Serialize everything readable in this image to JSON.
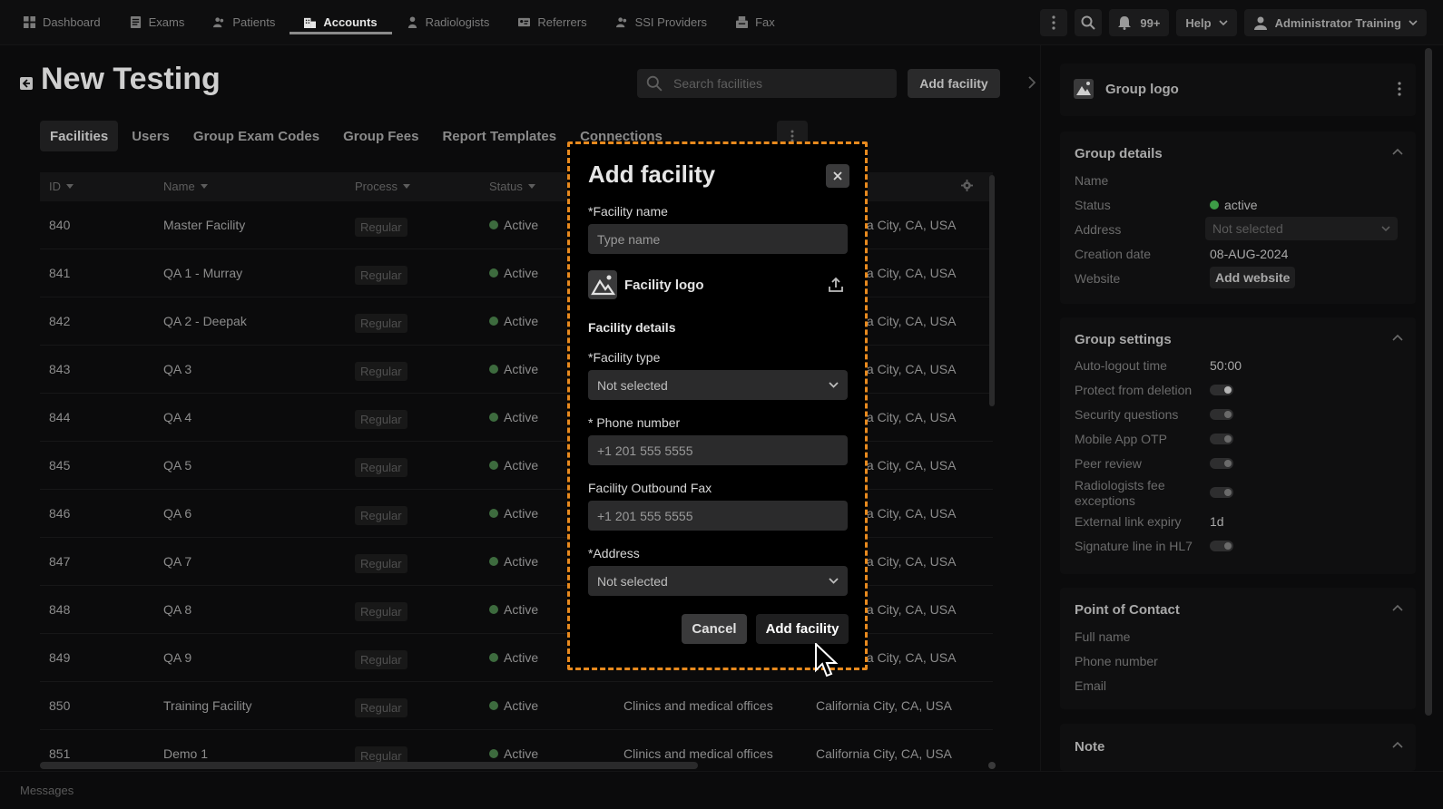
{
  "nav": {
    "items": [
      {
        "label": "Dashboard",
        "icon": "dashboard-icon"
      },
      {
        "label": "Exams",
        "icon": "exams-icon"
      },
      {
        "label": "Patients",
        "icon": "patients-icon"
      },
      {
        "label": "Accounts",
        "icon": "accounts-icon"
      },
      {
        "label": "Radiologists",
        "icon": "radiologist-icon"
      },
      {
        "label": "Referrers",
        "icon": "referrers-icon"
      },
      {
        "label": "SSI Providers",
        "icon": "ssi-providers-icon"
      },
      {
        "label": "Fax",
        "icon": "fax-icon"
      }
    ],
    "active": "Accounts",
    "notif_count": "99+",
    "help_label": "Help",
    "user_label": "Administrator Training"
  },
  "page": {
    "title": "New Testing",
    "search_placeholder": "Search facilities",
    "add_facility_label": "Add facility",
    "tabs": [
      "Facilities",
      "Users",
      "Group Exam Codes",
      "Group Fees",
      "Report Templates",
      "Connections"
    ]
  },
  "table": {
    "headers": {
      "id": "ID",
      "name": "Name",
      "process": "Process",
      "status": "Status"
    },
    "rows": [
      {
        "id": "840",
        "name": "Master Facility",
        "process": "Regular",
        "status": "Active",
        "type": "",
        "location": "nia City, CA, USA"
      },
      {
        "id": "841",
        "name": "QA 1 - Murray",
        "process": "Regular",
        "status": "Active",
        "type": "",
        "location": "nia City, CA, USA"
      },
      {
        "id": "842",
        "name": "QA 2 - Deepak",
        "process": "Regular",
        "status": "Active",
        "type": "",
        "location": "nia City, CA, USA"
      },
      {
        "id": "843",
        "name": "QA 3",
        "process": "Regular",
        "status": "Active",
        "type": "",
        "location": "nia City, CA, USA"
      },
      {
        "id": "844",
        "name": "QA 4",
        "process": "Regular",
        "status": "Active",
        "type": "",
        "location": "nia City, CA, USA"
      },
      {
        "id": "845",
        "name": "QA 5",
        "process": "Regular",
        "status": "Active",
        "type": "",
        "location": "nia City, CA, USA"
      },
      {
        "id": "846",
        "name": "QA 6",
        "process": "Regular",
        "status": "Active",
        "type": "",
        "location": "nia City, CA, USA"
      },
      {
        "id": "847",
        "name": "QA 7",
        "process": "Regular",
        "status": "Active",
        "type": "",
        "location": "nia City, CA, USA"
      },
      {
        "id": "848",
        "name": "QA 8",
        "process": "Regular",
        "status": "Active",
        "type": "",
        "location": "nia City, CA, USA"
      },
      {
        "id": "849",
        "name": "QA 9",
        "process": "Regular",
        "status": "Active",
        "type": "",
        "location": "nia City, CA, USA"
      },
      {
        "id": "850",
        "name": "Training Facility",
        "process": "Regular",
        "status": "Active",
        "type": "Clinics and medical offices",
        "location": "California City, CA, USA"
      },
      {
        "id": "851",
        "name": "Demo 1",
        "process": "Regular",
        "status": "Active",
        "type": "Clinics and medical offices",
        "location": "California City, CA, USA"
      }
    ]
  },
  "panel": {
    "logo_title": "Group logo",
    "group_details": {
      "title": "Group details",
      "name_label": "Name",
      "status_label": "Status",
      "status_value": "active",
      "address_label": "Address",
      "address_value": "Not selected",
      "creation_label": "Creation date",
      "creation_value": "08-AUG-2024",
      "website_label": "Website",
      "website_button": "Add website"
    },
    "group_settings": {
      "title": "Group settings",
      "autologout_label": "Auto-logout time",
      "autologout_value": "50:00",
      "protect_label": "Protect from deletion",
      "security_label": "Security questions",
      "otp_label": "Mobile App OTP",
      "peer_label": "Peer review",
      "fee_label": "Radiologists fee exceptions",
      "expiry_label": "External link expiry",
      "expiry_value": "1d",
      "signature_label": "Signature line in HL7"
    },
    "contact": {
      "title": "Point of Contact",
      "full_name": "Full name",
      "phone": "Phone number",
      "email": "Email"
    },
    "note_title": "Note"
  },
  "footer": {
    "messages": "Messages"
  },
  "modal": {
    "title": "Add facility",
    "facility_name_label": "*Facility name",
    "facility_name_placeholder": "Type name",
    "logo_label": "Facility logo",
    "details_heading": "Facility details",
    "facility_type_label": "*Facility type",
    "facility_type_value": "Not selected",
    "phone_label": "* Phone number",
    "phone_placeholder": "+1 201 555 5555",
    "fax_label": "Facility Outbound Fax",
    "fax_placeholder": "+1 201 555 5555",
    "address_label": "*Address",
    "address_value": "Not selected",
    "cancel_label": "Cancel",
    "submit_label": "Add facility"
  },
  "colors": {
    "accent_dashed": "#e88a1e",
    "status_active": "#3d6b3e"
  }
}
